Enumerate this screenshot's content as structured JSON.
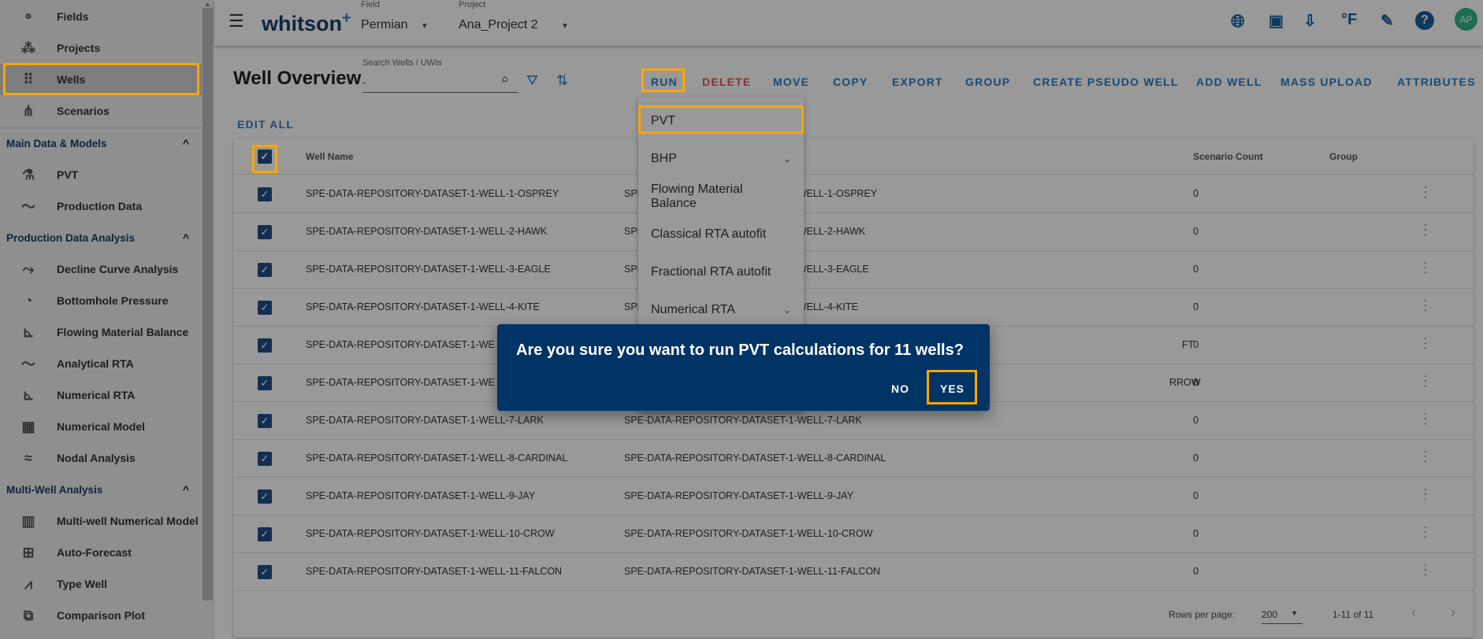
{
  "sidebar": {
    "nav": [
      {
        "label": "Fields",
        "icon": "fields-icon"
      },
      {
        "label": "Projects",
        "icon": "projects-icon"
      },
      {
        "label": "Wells",
        "icon": "wells-icon",
        "active": true
      },
      {
        "label": "Scenarios",
        "icon": "scenarios-icon"
      }
    ],
    "sections": [
      {
        "title": "Main Data & Models",
        "items": [
          {
            "label": "PVT"
          },
          {
            "label": "Production Data"
          }
        ]
      },
      {
        "title": "Production Data Analysis",
        "items": [
          {
            "label": "Decline Curve Analysis"
          },
          {
            "label": "Bottomhole Pressure"
          },
          {
            "label": "Flowing Material Balance"
          },
          {
            "label": "Analytical RTA"
          },
          {
            "label": "Numerical RTA"
          },
          {
            "label": "Numerical Model"
          },
          {
            "label": "Nodal Analysis"
          }
        ]
      },
      {
        "title": "Multi-Well Analysis",
        "items": [
          {
            "label": "Multi-well Numerical Model"
          },
          {
            "label": "Auto-Forecast"
          },
          {
            "label": "Type Well"
          },
          {
            "label": "Comparison Plot"
          }
        ]
      }
    ]
  },
  "topbar": {
    "logo": "whitson",
    "logo_plus": "+",
    "field_label": "Field",
    "field_value": "Permian",
    "project_label": "Project",
    "project_value": "Ana_Project 2",
    "temp_unit": "°F",
    "avatar": "AP"
  },
  "page": {
    "title": "Well Overview",
    "search_label": "Search Wells / UWIs",
    "search_value": "-",
    "edit_all": "EDIT ALL",
    "actions": [
      "RUN",
      "DELETE",
      "MOVE",
      "COPY",
      "EXPORT",
      "GROUP",
      "CREATE PSEUDO WELL",
      "ADD WELL",
      "MASS UPLOAD",
      "ATTRIBUTES"
    ]
  },
  "table": {
    "headers": {
      "name": "Well Name",
      "scenario_count": "Scenario Count",
      "group": "Group"
    },
    "rows": [
      {
        "name": "SPE-DATA-REPOSITORY-DATASET-1-WELL-1-OSPREY",
        "uwi": "SPE-DATA-REPOSITORY-DATASET-1-WELL-1-OSPREY",
        "count": "0"
      },
      {
        "name": "SPE-DATA-REPOSITORY-DATASET-1-WELL-2-HAWK",
        "uwi": "SPE-DATA-REPOSITORY-DATASET-1-WELL-2-HAWK",
        "count": "0"
      },
      {
        "name": "SPE-DATA-REPOSITORY-DATASET-1-WELL-3-EAGLE",
        "uwi": "SPE-DATA-REPOSITORY-DATASET-1-WELL-3-EAGLE",
        "count": "0"
      },
      {
        "name": "SPE-DATA-REPOSITORY-DATASET-1-WELL-4-KITE",
        "uwi": "SPE-DATA-REPOSITORY-DATASET-1-WELL-4-KITE",
        "count": "0"
      },
      {
        "name": "SPE-DATA-REPOSITORY-DATASET-1-WE",
        "uwi": "FT",
        "count": "0"
      },
      {
        "name": "SPE-DATA-REPOSITORY-DATASET-1-WE",
        "uwi": "RROW",
        "count": "0"
      },
      {
        "name": "SPE-DATA-REPOSITORY-DATASET-1-WELL-7-LARK",
        "uwi": "SPE-DATA-REPOSITORY-DATASET-1-WELL-7-LARK",
        "count": "0"
      },
      {
        "name": "SPE-DATA-REPOSITORY-DATASET-1-WELL-8-CARDINAL",
        "uwi": "SPE-DATA-REPOSITORY-DATASET-1-WELL-8-CARDINAL",
        "count": "0"
      },
      {
        "name": "SPE-DATA-REPOSITORY-DATASET-1-WELL-9-JAY",
        "uwi": "SPE-DATA-REPOSITORY-DATASET-1-WELL-9-JAY",
        "count": "0"
      },
      {
        "name": "SPE-DATA-REPOSITORY-DATASET-1-WELL-10-CROW",
        "uwi": "SPE-DATA-REPOSITORY-DATASET-1-WELL-10-CROW",
        "count": "0"
      },
      {
        "name": "SPE-DATA-REPOSITORY-DATASET-1-WELL-11-FALCON",
        "uwi": "SPE-DATA-REPOSITORY-DATASET-1-WELL-11-FALCON",
        "count": "0"
      }
    ],
    "footer": {
      "rows_per_page_label": "Rows per page:",
      "rows_per_page": "200",
      "range": "1-11 of 11"
    }
  },
  "run_menu": {
    "items": [
      {
        "label": "PVT",
        "expandable": false
      },
      {
        "label": "BHP",
        "expandable": true
      },
      {
        "label": "Flowing Material Balance",
        "expandable": false
      },
      {
        "label": "Classical RTA autofit",
        "expandable": false
      },
      {
        "label": "Fractional RTA autofit",
        "expandable": false
      },
      {
        "label": "Numerical RTA",
        "expandable": true
      }
    ]
  },
  "dialog": {
    "message": "Are you sure you want to run PVT calculations for 11 wells?",
    "no": "NO",
    "yes": "YES"
  },
  "colors": {
    "accent": "#2a7cc4",
    "danger": "#e05555",
    "dialog_bg": "#003366",
    "highlight": "#ffa500",
    "avatar": "#2fb58b"
  }
}
